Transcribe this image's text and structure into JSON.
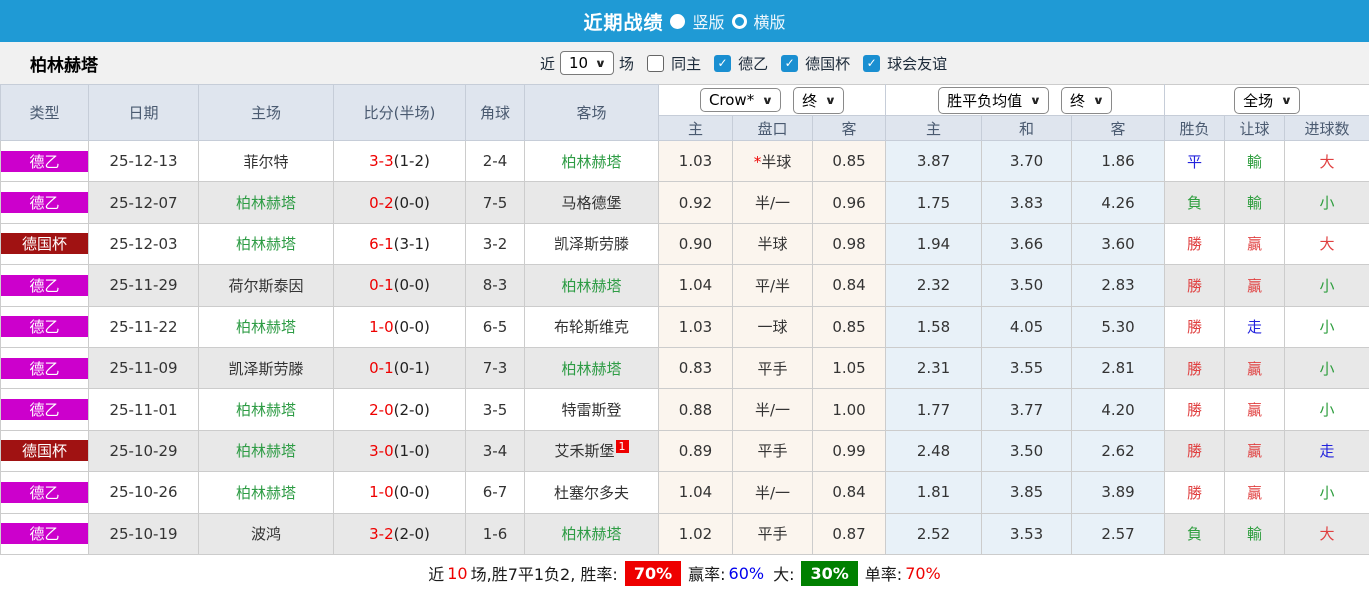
{
  "topbar": {
    "title": "近期战绩",
    "radio_vertical_label": "竖版",
    "radio_horizontal_label": "横版",
    "selected_view": "竖版"
  },
  "filterbar": {
    "team": "柏林赫塔",
    "near_label": "近",
    "games_count": "10",
    "games_suffix": "场",
    "same_home": {
      "label": "同主",
      "checked": false
    },
    "leagues": [
      {
        "label": "德乙",
        "checked": true
      },
      {
        "label": "德国杯",
        "checked": true
      },
      {
        "label": "球会友谊",
        "checked": true
      }
    ]
  },
  "table": {
    "left_headers": [
      "类型",
      "日期",
      "主场",
      "比分(半场)",
      "角球",
      "客场"
    ],
    "sub_headers": [
      "主",
      "盘口",
      "客",
      "主",
      "和",
      "客",
      "胜负",
      "让球",
      "进球数"
    ],
    "dropdowns": {
      "odds_source": "Crow*",
      "odds_time1": "终",
      "avg_label": "胜平负均值",
      "odds_time2": "终",
      "scope": "全场"
    },
    "rows": [
      {
        "type": "德乙",
        "type_color": "#cc00cc",
        "date": "25-12-13",
        "home": "菲尔特",
        "home_is_target": false,
        "score": "3-3",
        "half": "(1-2)",
        "corner": "2-4",
        "away": "柏林赫塔",
        "away_is_target": true,
        "away_badge": "",
        "odds_home": "1.03",
        "handicap": "半球",
        "handicap_star": true,
        "odds_away": "0.85",
        "avg_home": "3.87",
        "avg_draw": "3.70",
        "avg_away": "1.86",
        "result_outcome": {
          "text": "平",
          "color": "blue"
        },
        "result_handicap": {
          "text": "輸",
          "color": "green"
        },
        "result_goals": {
          "text": "大",
          "color": "red"
        }
      },
      {
        "type": "德乙",
        "type_color": "#cc00cc",
        "date": "25-12-07",
        "home": "柏林赫塔",
        "home_is_target": true,
        "score": "0-2",
        "half": "(0-0)",
        "corner": "7-5",
        "away": "马格德堡",
        "away_is_target": false,
        "away_badge": "",
        "odds_home": "0.92",
        "handicap": "半/一",
        "handicap_star": false,
        "odds_away": "0.96",
        "avg_home": "1.75",
        "avg_draw": "3.83",
        "avg_away": "4.26",
        "result_outcome": {
          "text": "負",
          "color": "green"
        },
        "result_handicap": {
          "text": "輸",
          "color": "green"
        },
        "result_goals": {
          "text": "小",
          "color": "green"
        }
      },
      {
        "type": "德国杯",
        "type_color": "#a01212",
        "date": "25-12-03",
        "home": "柏林赫塔",
        "home_is_target": true,
        "score": "6-1",
        "half": "(3-1)",
        "corner": "3-2",
        "away": "凯泽斯劳滕",
        "away_is_target": false,
        "away_badge": "",
        "odds_home": "0.90",
        "handicap": "半球",
        "handicap_star": false,
        "odds_away": "0.98",
        "avg_home": "1.94",
        "avg_draw": "3.66",
        "avg_away": "3.60",
        "result_outcome": {
          "text": "勝",
          "color": "red"
        },
        "result_handicap": {
          "text": "贏",
          "color": "red"
        },
        "result_goals": {
          "text": "大",
          "color": "red"
        }
      },
      {
        "type": "德乙",
        "type_color": "#cc00cc",
        "date": "25-11-29",
        "home": "荷尔斯泰因",
        "home_is_target": false,
        "score": "0-1",
        "half": "(0-0)",
        "corner": "8-3",
        "away": "柏林赫塔",
        "away_is_target": true,
        "away_badge": "",
        "odds_home": "1.04",
        "handicap": "平/半",
        "handicap_star": false,
        "odds_away": "0.84",
        "avg_home": "2.32",
        "avg_draw": "3.50",
        "avg_away": "2.83",
        "result_outcome": {
          "text": "勝",
          "color": "red"
        },
        "result_handicap": {
          "text": "贏",
          "color": "red"
        },
        "result_goals": {
          "text": "小",
          "color": "green"
        }
      },
      {
        "type": "德乙",
        "type_color": "#cc00cc",
        "date": "25-11-22",
        "home": "柏林赫塔",
        "home_is_target": true,
        "score": "1-0",
        "half": "(0-0)",
        "corner": "6-5",
        "away": "布轮斯维克",
        "away_is_target": false,
        "away_badge": "",
        "odds_home": "1.03",
        "handicap": "一球",
        "handicap_star": false,
        "odds_away": "0.85",
        "avg_home": "1.58",
        "avg_draw": "4.05",
        "avg_away": "5.30",
        "result_outcome": {
          "text": "勝",
          "color": "red"
        },
        "result_handicap": {
          "text": "走",
          "color": "blue"
        },
        "result_goals": {
          "text": "小",
          "color": "green"
        }
      },
      {
        "type": "德乙",
        "type_color": "#cc00cc",
        "date": "25-11-09",
        "home": "凯泽斯劳滕",
        "home_is_target": false,
        "score": "0-1",
        "half": "(0-1)",
        "corner": "7-3",
        "away": "柏林赫塔",
        "away_is_target": true,
        "away_badge": "",
        "odds_home": "0.83",
        "handicap": "平手",
        "handicap_star": false,
        "odds_away": "1.05",
        "avg_home": "2.31",
        "avg_draw": "3.55",
        "avg_away": "2.81",
        "result_outcome": {
          "text": "勝",
          "color": "red"
        },
        "result_handicap": {
          "text": "贏",
          "color": "red"
        },
        "result_goals": {
          "text": "小",
          "color": "green"
        }
      },
      {
        "type": "德乙",
        "type_color": "#cc00cc",
        "date": "25-11-01",
        "home": "柏林赫塔",
        "home_is_target": true,
        "score": "2-0",
        "half": "(2-0)",
        "corner": "3-5",
        "away": "特雷斯登",
        "away_is_target": false,
        "away_badge": "",
        "odds_home": "0.88",
        "handicap": "半/一",
        "handicap_star": false,
        "odds_away": "1.00",
        "avg_home": "1.77",
        "avg_draw": "3.77",
        "avg_away": "4.20",
        "result_outcome": {
          "text": "勝",
          "color": "red"
        },
        "result_handicap": {
          "text": "贏",
          "color": "red"
        },
        "result_goals": {
          "text": "小",
          "color": "green"
        }
      },
      {
        "type": "德国杯",
        "type_color": "#a01212",
        "date": "25-10-29",
        "home": "柏林赫塔",
        "home_is_target": true,
        "score": "3-0",
        "half": "(1-0)",
        "corner": "3-4",
        "away": "艾禾斯堡",
        "away_is_target": false,
        "away_badge": "1",
        "odds_home": "0.89",
        "handicap": "平手",
        "handicap_star": false,
        "odds_away": "0.99",
        "avg_home": "2.48",
        "avg_draw": "3.50",
        "avg_away": "2.62",
        "result_outcome": {
          "text": "勝",
          "color": "red"
        },
        "result_handicap": {
          "text": "贏",
          "color": "red"
        },
        "result_goals": {
          "text": "走",
          "color": "blue"
        }
      },
      {
        "type": "德乙",
        "type_color": "#cc00cc",
        "date": "25-10-26",
        "home": "柏林赫塔",
        "home_is_target": true,
        "score": "1-0",
        "half": "(0-0)",
        "corner": "6-7",
        "away": "杜塞尔多夫",
        "away_is_target": false,
        "away_badge": "",
        "odds_home": "1.04",
        "handicap": "半/一",
        "handicap_star": false,
        "odds_away": "0.84",
        "avg_home": "1.81",
        "avg_draw": "3.85",
        "avg_away": "3.89",
        "result_outcome": {
          "text": "勝",
          "color": "red"
        },
        "result_handicap": {
          "text": "贏",
          "color": "red"
        },
        "result_goals": {
          "text": "小",
          "color": "green"
        }
      },
      {
        "type": "德乙",
        "type_color": "#cc00cc",
        "date": "25-10-19",
        "home": "波鸿",
        "home_is_target": false,
        "score": "3-2",
        "half": "(2-0)",
        "corner": "1-6",
        "away": "柏林赫塔",
        "away_is_target": true,
        "away_badge": "",
        "odds_home": "1.02",
        "handicap": "平手",
        "handicap_star": false,
        "odds_away": "0.87",
        "avg_home": "2.52",
        "avg_draw": "3.53",
        "avg_away": "2.57",
        "result_outcome": {
          "text": "負",
          "color": "green"
        },
        "result_handicap": {
          "text": "輸",
          "color": "green"
        },
        "result_goals": {
          "text": "大",
          "color": "red"
        }
      }
    ]
  },
  "summary": {
    "near_label": "近",
    "near_count": "10",
    "after_count": "场,胜7平1负2, 胜率:",
    "win_rate": "70%",
    "profit_label": "赢率:",
    "profit_rate": "60%",
    "big_label": "大:",
    "big_rate": "30%",
    "single_label": "单率:",
    "single_rate": "70%"
  },
  "colors": {
    "accent_blue": "#1f9ad5",
    "league_magenta": "#cc00cc",
    "cup_dark_red": "#a01212",
    "score_red": "#ee0000",
    "target_team_green": "#2e9c45",
    "result_red": "#e04040",
    "result_blue": "#2323dd",
    "result_green": "#2f9e3f",
    "win_badge_red": "#ee0000",
    "big_badge_green": "#008000"
  }
}
